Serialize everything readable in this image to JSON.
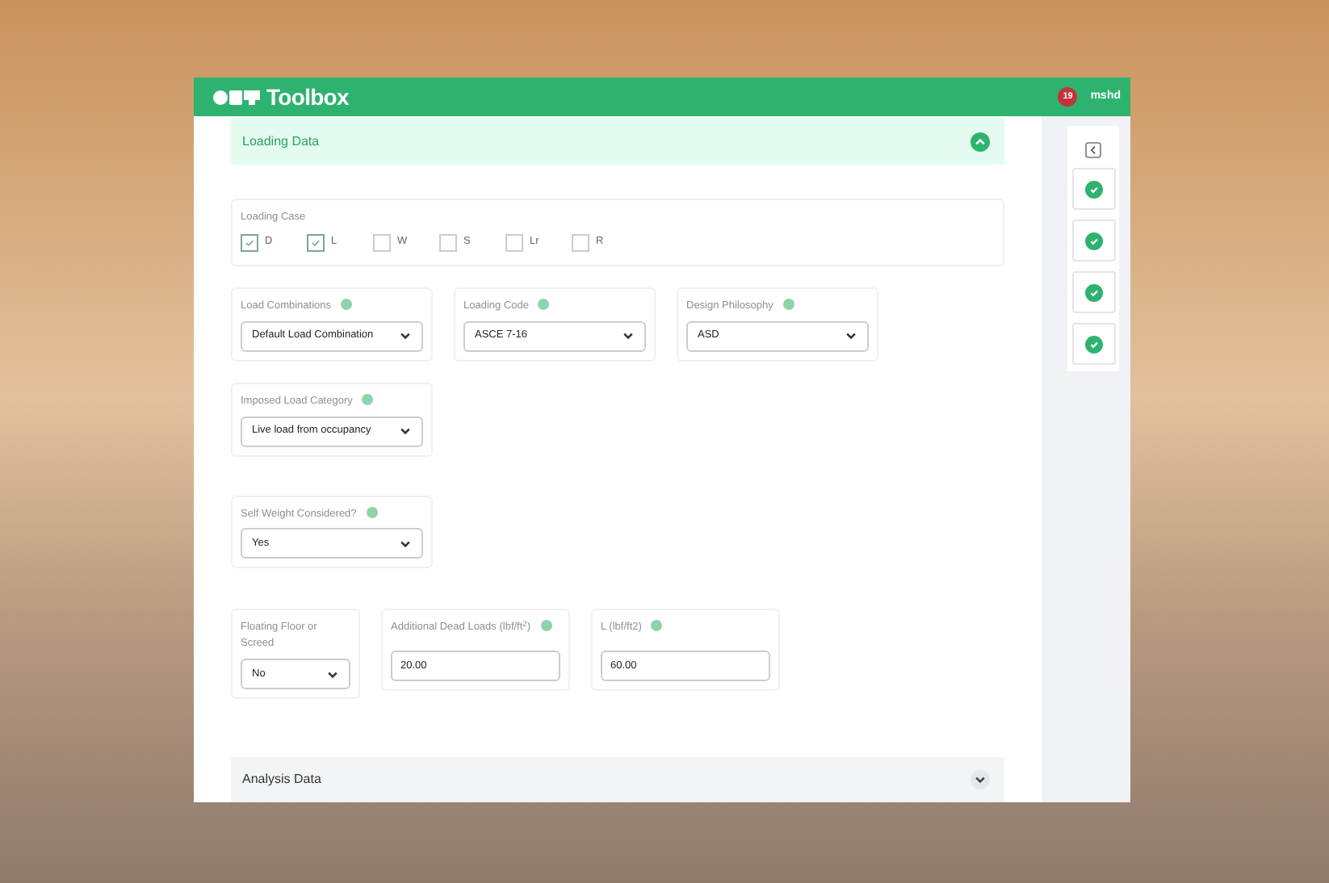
{
  "header": {
    "logo": "Toolbox",
    "badge": "19",
    "user": "mshd"
  },
  "loading_data": {
    "title": "Loading Data",
    "expanded": true,
    "loading_case": {
      "label": "Loading Case",
      "options": [
        {
          "label": "D",
          "checked": true
        },
        {
          "label": "L",
          "checked": true
        },
        {
          "label": "W",
          "checked": false
        },
        {
          "label": "S",
          "checked": false
        },
        {
          "label": "Lr",
          "checked": false
        },
        {
          "label": "R",
          "checked": false
        }
      ]
    },
    "rows": [
      [
        {
          "kind": "select",
          "label": "Load Combinations",
          "info": true,
          "value": "Default Load Combination"
        },
        {
          "kind": "select",
          "label": "Loading Code",
          "info": true,
          "value": "ASCE 7-16"
        },
        {
          "kind": "select",
          "label": "Design Philosophy",
          "info": true,
          "value": "ASD"
        }
      ],
      [
        {
          "kind": "select",
          "label": "Imposed Load Category",
          "info": true,
          "value": "Live load from occupancy"
        }
      ],
      [
        {
          "kind": "select",
          "label": "Self Weight Considered?",
          "info": true,
          "value": "Yes"
        }
      ],
      [
        {
          "kind": "select",
          "label": "Floating Floor or Screed",
          "info": false,
          "value": "No",
          "narrow": true
        },
        {
          "kind": "input",
          "label": "Additional Dead Loads (lbf/ft$^{2}$)",
          "info": true,
          "value": "20.00"
        },
        {
          "kind": "input",
          "label": "L (lbf/ft2)",
          "info": true,
          "value": "60.00"
        }
      ]
    ]
  },
  "analysis_data": {
    "title": "Analysis Data",
    "expanded": false
  },
  "steps": [
    {
      "done": true
    },
    {
      "done": true
    },
    {
      "done": true
    },
    {
      "done": true
    }
  ]
}
